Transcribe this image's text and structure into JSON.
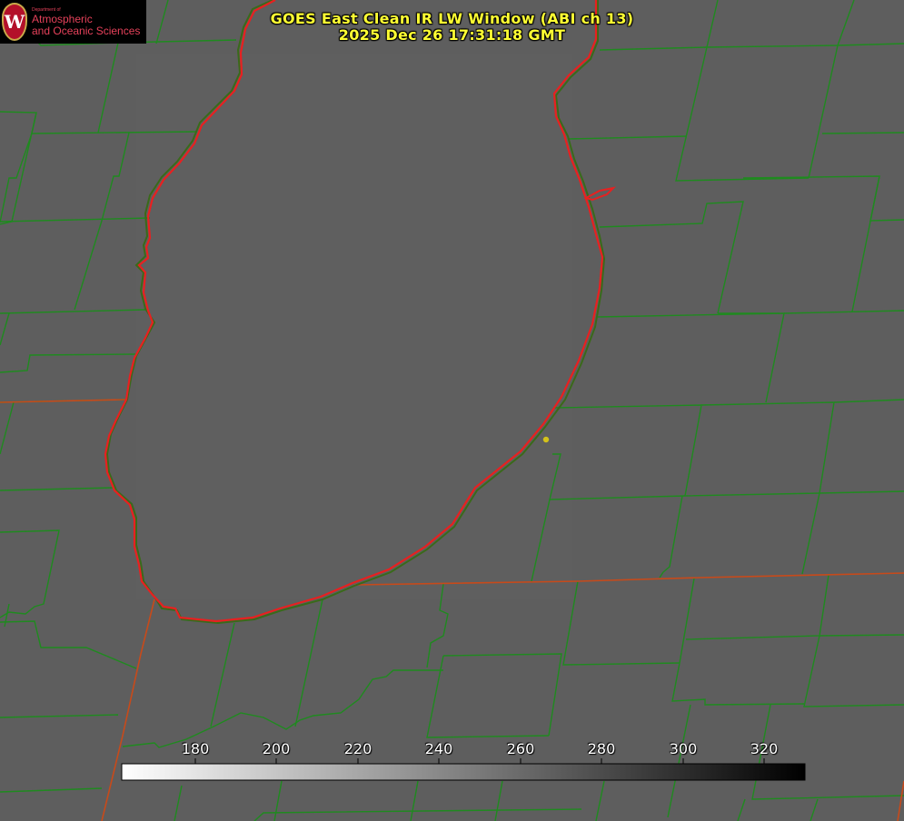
{
  "title": {
    "line1": "GOES East Clean IR LW Window (ABI ch 13)",
    "line2": "2025 Dec 26 17:31:18 GMT"
  },
  "logo": {
    "small_text": "Department of",
    "line1": "Atmospheric",
    "line2": "and Oceanic Sciences",
    "seal_letter": "W"
  },
  "colorbar": {
    "ticks": [
      "180",
      "200",
      "220",
      "240",
      "260",
      "280",
      "300",
      "320"
    ],
    "scheme": "white (cold) to black (warm) grayscale"
  },
  "colors": {
    "background": "#5e5e5e",
    "county_lines": "#1f8a1f",
    "state_lines": "#c84a1a",
    "lake_outline": "#e82020",
    "title_text": "#ffff33",
    "marker": "#d4c21a"
  },
  "map": {
    "features": [
      "lake-outline",
      "county-boundaries",
      "state-boundaries",
      "city-marker"
    ]
  }
}
